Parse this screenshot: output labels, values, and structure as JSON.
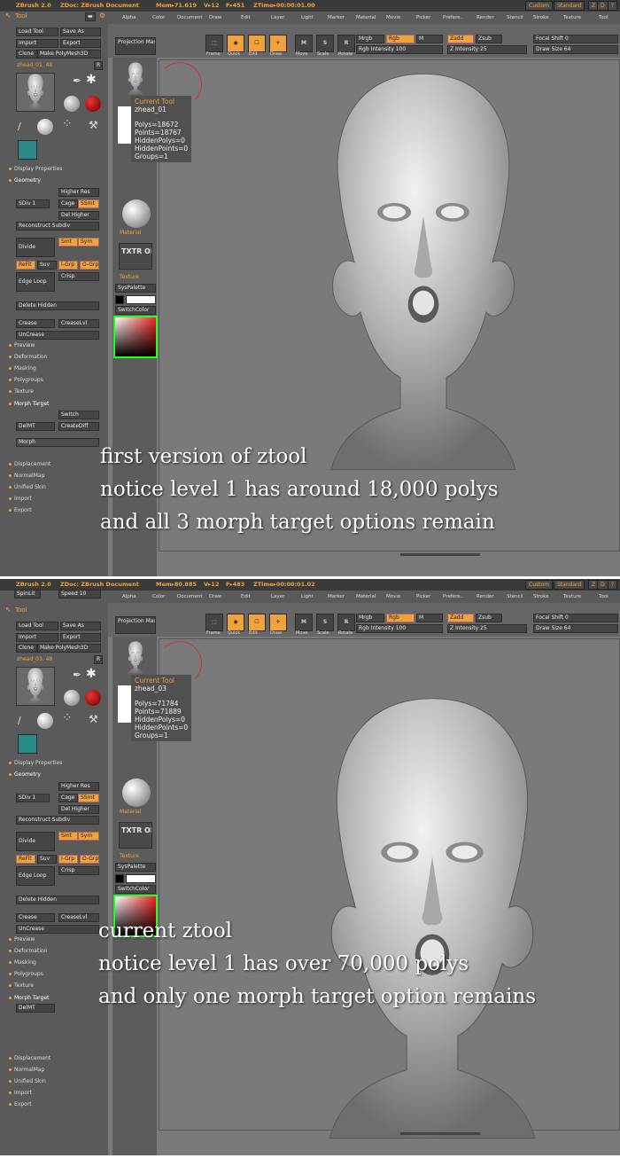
{
  "app": {
    "title": "ZBrush 2.0",
    "doc": "ZDoc: ZBrush Document"
  },
  "colors": {
    "accent": "#f0a23c",
    "panel": "#5a5a5a",
    "viewport": "#7a7a7a"
  },
  "panels": [
    {
      "status": {
        "mem": "Mem▸71.619",
        "v": "V▸12",
        "f": "F▸451",
        "ztime": "ZTime▸00:00:01.00"
      },
      "topright": {
        "custom": "Custom",
        "standard": "Standard",
        "z": "Z",
        "d": "D",
        "help": "?"
      },
      "spinlit": "",
      "speed": "",
      "tool_header": "Tool",
      "tool_name": "zhead_01. 48",
      "info": {
        "title": "Current Tool",
        "name": "zhead_01",
        "stats": "Polys=18672\nPoints=18767\nHiddenPolys=0\nHiddenPoints=0\nGroups=1"
      },
      "caption": [
        "first version of  ztool",
        "notice level 1 has around 18,000 polys",
        "and all 3 morph target options remain"
      ],
      "morph_buttons": [
        "Switch",
        "DelMT",
        "CreateDiff"
      ],
      "morph_label": "Morph"
    },
    {
      "status": {
        "mem": "Mem▸80.885",
        "v": "V▸12",
        "f": "F▸483",
        "ztime": "ZTime▸00:00:01.02"
      },
      "topright": {
        "custom": "Custom",
        "standard": "Standard",
        "z": "Z",
        "d": "D",
        "help": "?"
      },
      "spinlit": "SpinLit",
      "speed": "Speed 10",
      "tool_header": "Tool",
      "tool_name": "zhead_03. 48",
      "info": {
        "title": "Current Tool",
        "name": "zhead_03",
        "stats": "Polys=71784\nPoints=71889\nHiddenPolys=0\nHiddenPoints=0\nGroups=1"
      },
      "caption": [
        "current ztool",
        "notice level 1 has over 70,000 polys",
        "and only one morph target option remains"
      ],
      "morph_buttons": [
        "DelMT"
      ],
      "morph_label": ""
    }
  ],
  "menu": [
    "Alpha",
    "Color",
    "Document",
    "Draw",
    "Edit",
    "Layer",
    "Light",
    "Marker",
    "Material",
    "Movie",
    "Picker",
    "Prefere..",
    "Render",
    "Stencil",
    "Stroke",
    "Texture",
    "Tool"
  ],
  "current_tool": "Current Tool",
  "projection_master": [
    "Projection",
    "Master"
  ],
  "transform": {
    "frame": "Frame",
    "quick": "Quick",
    "edit": "Edit",
    "draw": "Draw",
    "move": "Move",
    "scale": "Scale",
    "rotate": "Rotate"
  },
  "draw_opts": {
    "mrgb": "Mrgb",
    "rgb": "Rgb",
    "m": "M",
    "zadd": "Zadd",
    "zsub": "Zsub",
    "rgb_intensity": "Rgb Intensity 100",
    "z_intensity": "Z Intensity 25",
    "focal_shift": "Focal Shift 0",
    "draw_size": "Draw Size 64"
  },
  "left": {
    "load_tool": "Load Tool",
    "save_as": "Save As",
    "import": "Import",
    "export": "Export",
    "clone": "Clone",
    "make_polymesh": "Make PolyMesh3D",
    "r": "R",
    "display_properties": "Display Properties",
    "geometry": "Geometry",
    "higher_res": "Higher Res",
    "sdiv": "SDiv 1",
    "cage": "Cage",
    "ssmt": "SSmt",
    "del_higher": "Del Higher",
    "reconstruct": "Reconstruct Subdiv",
    "divide": "Divide",
    "smt": "Smt",
    "sym": "Sym",
    "refit": "ReFit",
    "suv": "Suv",
    "igrp": "I-Grp",
    "ogrp": "O-Grp",
    "crisp": "Crisp",
    "edge_loop": "Edge Loop",
    "delete_hidden": "Delete Hidden",
    "crease": "Crease",
    "creaselvl": "CreaseLvl",
    "uncrease": "UnCrease",
    "sections": [
      "Preview",
      "Deformation",
      "Masking",
      "Polygroups",
      "Texture"
    ],
    "morph_target": "Morph Target",
    "bottom_sections": [
      "Displacement",
      "NormalMap",
      "Unified Skin",
      "Import",
      "Export"
    ]
  },
  "palette": {
    "material": "Material",
    "txtr": "TXTR",
    "off": "OFF",
    "texture": "Texture",
    "syspalette": "SysPalette",
    "switchcolor": "SwitchColor"
  }
}
